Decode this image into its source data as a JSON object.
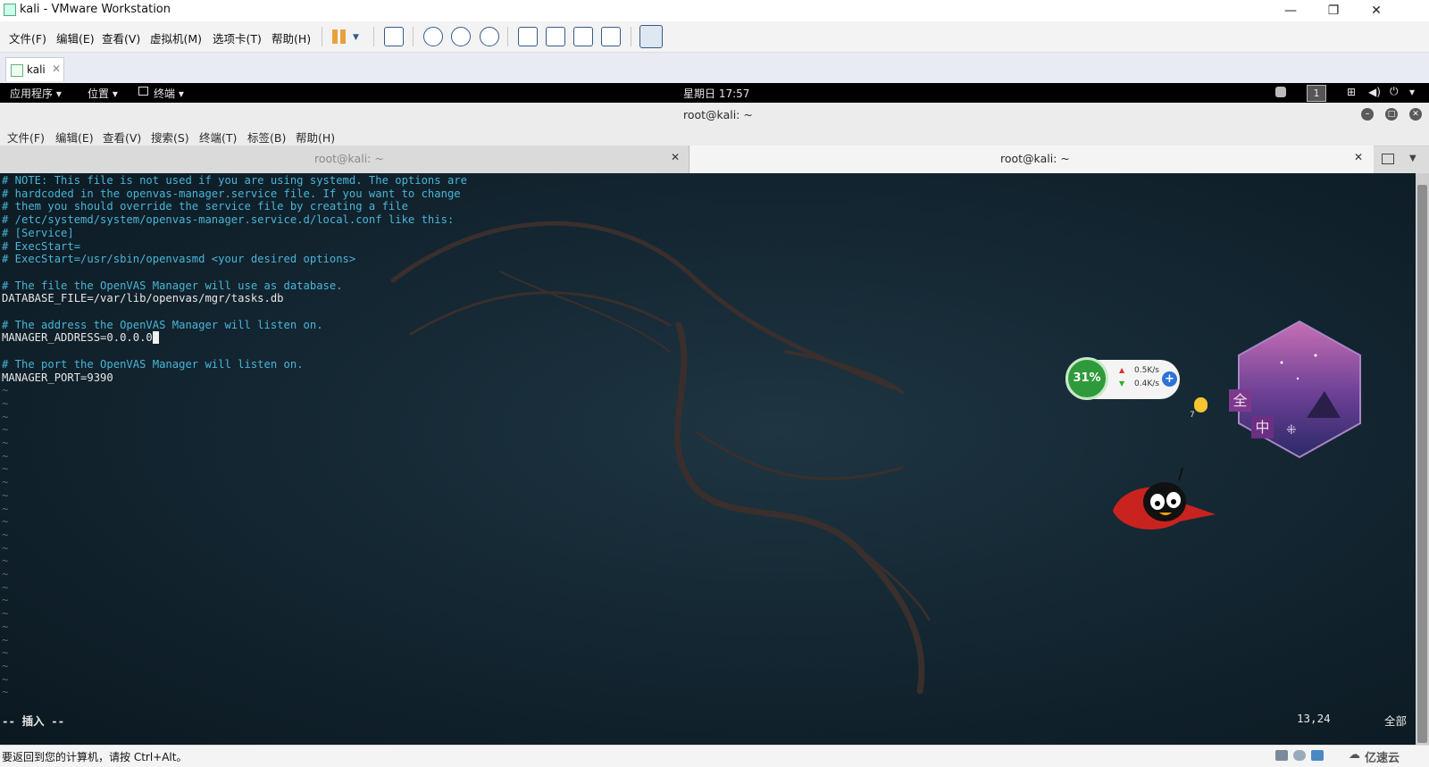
{
  "vmware": {
    "title": "kali - VMware Workstation",
    "menu": [
      "文件(F)",
      "编辑(E)",
      "查看(V)",
      "虚拟机(M)",
      "选项卡(T)",
      "帮助(H)"
    ],
    "tab_label": "kali",
    "status_text": "要返回到您的计算机，请按 Ctrl+Alt。",
    "watermark": "亿速云"
  },
  "kali_bar": {
    "apps": "应用程序",
    "places": "位置",
    "terminal": "终端",
    "clock": "星期日 17:57",
    "workspace": "1"
  },
  "terminal": {
    "title": "root@kali: ~",
    "menu": [
      "文件(F)",
      "编辑(E)",
      "查看(V)",
      "搜索(S)",
      "终端(T)",
      "标签(B)",
      "帮助(H)"
    ],
    "tabs": [
      "root@kali: ~",
      "root@kali: ~"
    ],
    "lines": [
      {
        "t": "# NOTE: This file is not used if you are using systemd. The options are",
        "c": "cm"
      },
      {
        "t": "# hardcoded in the openvas-manager.service file. If you want to change",
        "c": "cm"
      },
      {
        "t": "# them you should override the service file by creating a file",
        "c": "cm"
      },
      {
        "t": "# /etc/systemd/system/openvas-manager.service.d/local.conf like this:",
        "c": "cm"
      },
      {
        "t": "# [Service]",
        "c": "cm"
      },
      {
        "t": "# ExecStart=",
        "c": "cm"
      },
      {
        "t": "# ExecStart=/usr/sbin/openvasmd <your desired options>",
        "c": "cm"
      },
      {
        "t": "",
        "c": "tx"
      },
      {
        "t": "# The file the OpenVAS Manager will use as database.",
        "c": "cm"
      },
      {
        "t": "DATABASE_FILE=/var/lib/openvas/mgr/tasks.db",
        "c": "tx"
      },
      {
        "t": "",
        "c": "tx"
      },
      {
        "t": "# The address the OpenVAS Manager will listen on.",
        "c": "cm"
      },
      {
        "t": "MANAGER_ADDRESS=0.0.0.0",
        "c": "tx",
        "cursor": true
      },
      {
        "t": "",
        "c": "tx"
      },
      {
        "t": "# The port the OpenVAS Manager will listen on.",
        "c": "cm"
      },
      {
        "t": "MANAGER_PORT=9390",
        "c": "tx"
      }
    ],
    "tilde": "~",
    "mode": "-- 插入 --",
    "position": "13,24",
    "scope": "全部"
  },
  "widget": {
    "cpu": "31%",
    "up": "0.5K/s",
    "down": "0.4K/s",
    "bulb_count": "7",
    "ime_full": "全",
    "ime_cn": "中"
  }
}
